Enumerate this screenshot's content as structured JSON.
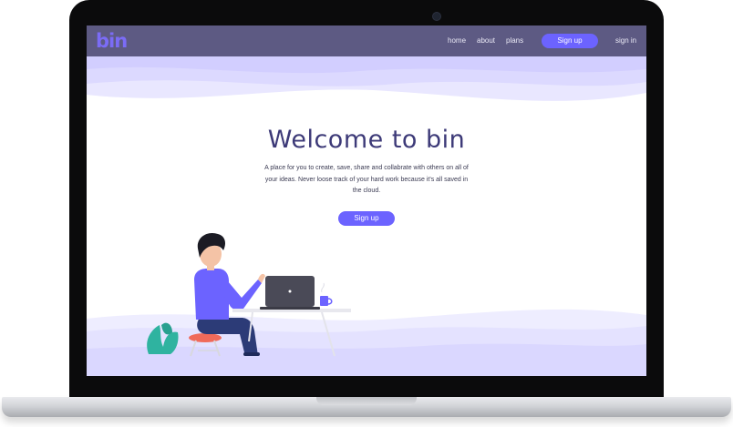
{
  "nav": {
    "logo": "bin",
    "links": {
      "home": "home",
      "about": "about",
      "plans": "plans"
    },
    "signup_label": "Sign up",
    "signin_label": "sign in"
  },
  "hero": {
    "title": "Welcome to bin",
    "description": "A place for you to create, save, share and collabrate with others on all of your ideas. Never loose track of your hard work because it's all saved in the cloud.",
    "signup_label": "Sign up"
  },
  "colors": {
    "nav_bg": "#5d5a83",
    "accent": "#6c63ff",
    "title": "#3d3a78",
    "wave": "#e6e4ff"
  },
  "icons": [
    "laptop-icon",
    "mug-icon",
    "plant-icon"
  ]
}
